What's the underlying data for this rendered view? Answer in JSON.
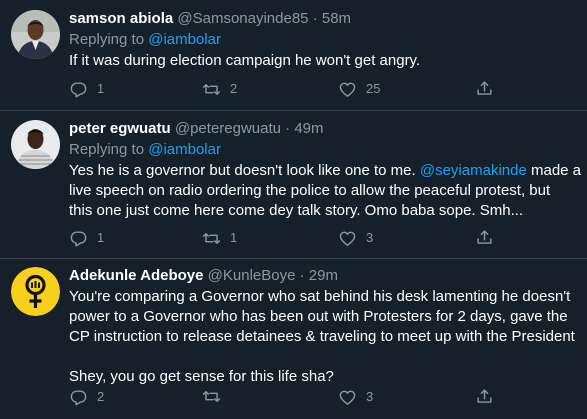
{
  "tweets": [
    {
      "name": "samson abiola",
      "handle": "@Samsonayinde85",
      "time": "· 58m",
      "replying_prefix": "Replying to",
      "replying_handle": "@iambolar",
      "text_lines": [
        "If it was during election campaign he won't get angry."
      ],
      "replies": "1",
      "retweets": "2",
      "likes": "25"
    },
    {
      "name": "peter egwuatu",
      "handle": "@peteregwuatu",
      "time": "· 49m",
      "replying_prefix": "Replying to",
      "replying_handle": "@iambolar",
      "text_line1_pre": "Yes he is a governor but doesn't look like one to me. ",
      "text_line1_mention": "@seyiamakinde",
      "text_line1_post": " made a",
      "text_line2": "live speech on radio ordering the police to allow the peaceful protest, but",
      "text_line3": "this one just come here come dey talk story. Omo baba sope. Smh...",
      "replies": "1",
      "retweets": "1",
      "likes": "3"
    },
    {
      "name": "Adekunle Adeboye",
      "handle": "@KunleBoye",
      "time": "· 29m",
      "text_lines": [
        "You're comparing a Governor who sat behind his desk lamenting he doesn't",
        "power to a Governor who has been out with Protesters for 2 days, gave the",
        "CP instruction to release detainees & traveling to meet up with the President",
        "",
        "Shey, you go get sense for this life sha?"
      ],
      "replies": "2",
      "retweets": "",
      "likes": "3"
    }
  ],
  "icons": [
    "reply-icon",
    "retweet-icon",
    "like-icon",
    "share-icon"
  ],
  "colors": {
    "background": "#15202b",
    "divider": "#38444d",
    "secondary_text": "#8899a6",
    "link": "#1da1f2",
    "feminist_badge": "#f6d01c"
  }
}
